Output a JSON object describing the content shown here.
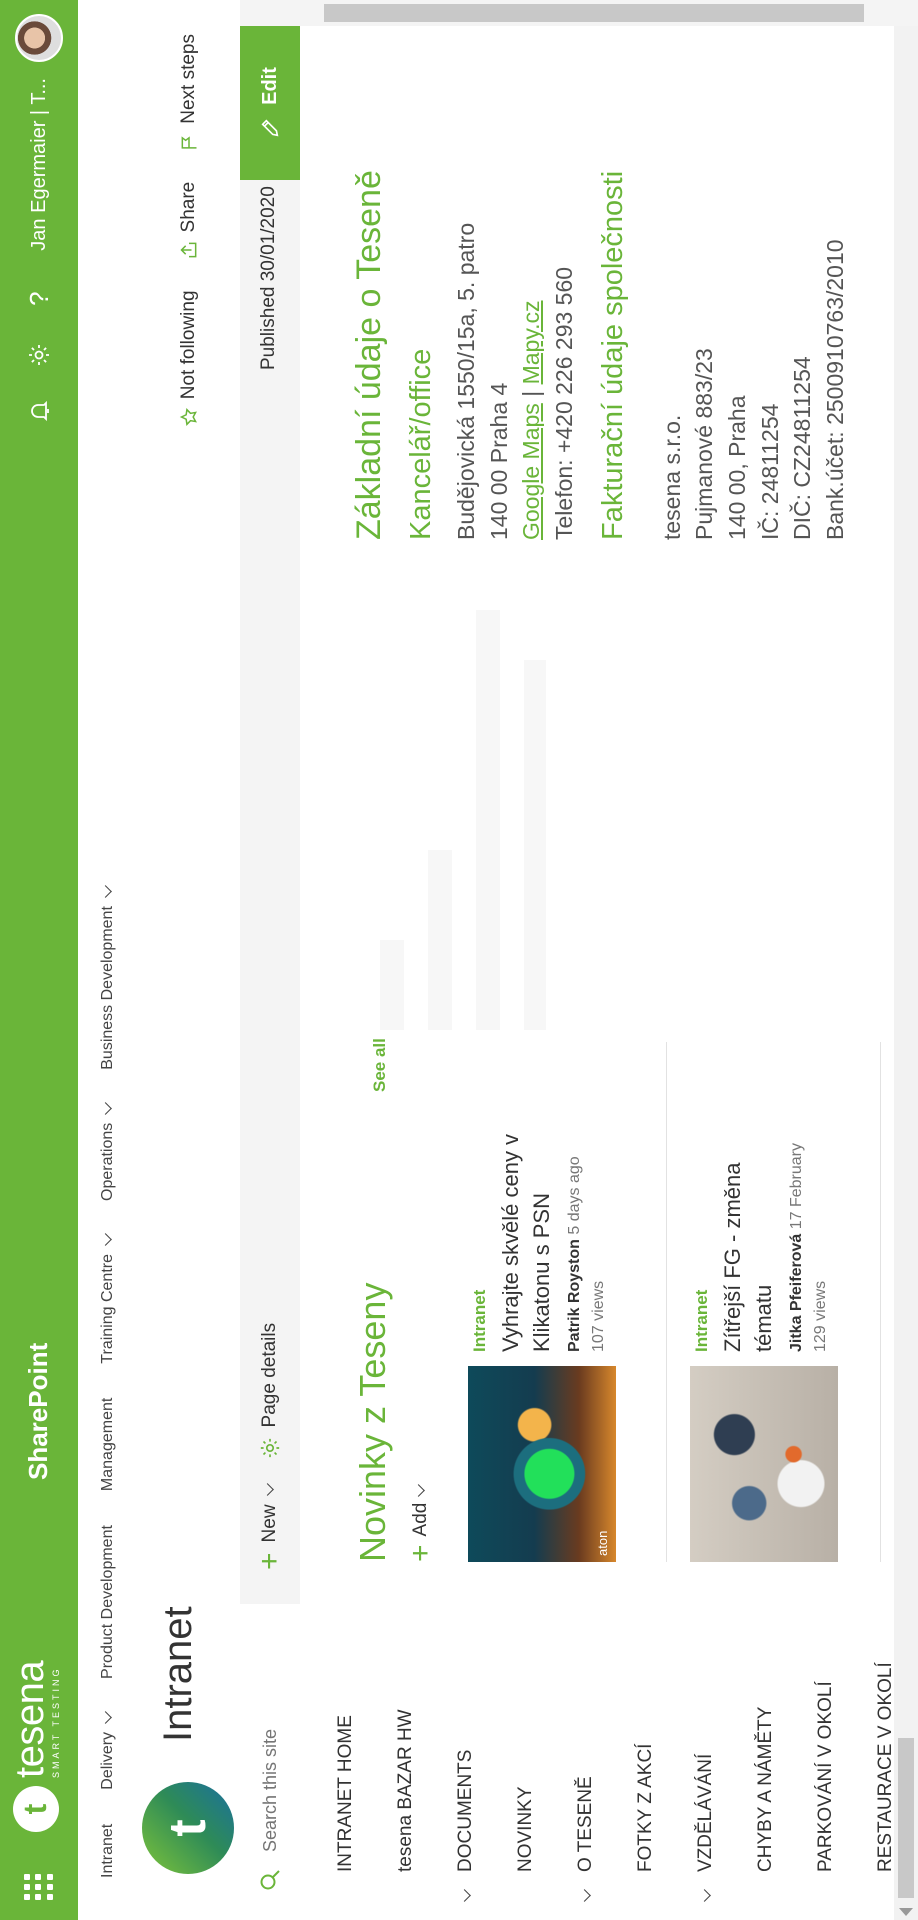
{
  "suite": {
    "brand_name": "tesena",
    "brand_tagline": "SMART TESTING",
    "app_title": "SharePoint",
    "user_name": "Jan Egermaier | T...",
    "accent": "#6ab539"
  },
  "topnav": [
    {
      "label": "Intranet",
      "has_menu": false
    },
    {
      "label": "Delivery",
      "has_menu": true
    },
    {
      "label": "Product Development",
      "has_menu": false
    },
    {
      "label": "Management",
      "has_menu": false
    },
    {
      "label": "Training Centre",
      "has_menu": true
    },
    {
      "label": "Operations",
      "has_menu": true
    },
    {
      "label": "Business Development",
      "has_menu": true
    }
  ],
  "site": {
    "title": "Intranet",
    "actions": {
      "follow": "Not following",
      "share": "Share",
      "next_steps": "Next steps"
    }
  },
  "commandbar": {
    "search_placeholder": "Search this site",
    "new_label": "New",
    "page_details_label": "Page details",
    "published": "Published 30/01/2020",
    "edit_label": "Edit"
  },
  "leftnav": [
    {
      "label": "INTRANET HOME",
      "expandable": false
    },
    {
      "label": "tesena BAZAR HW",
      "expandable": false
    },
    {
      "label": "DOCUMENTS",
      "expandable": true
    },
    {
      "label": "NOVINKY",
      "expandable": false
    },
    {
      "label": "O TESENĚ",
      "expandable": true
    },
    {
      "label": "FOTKY Z AKCÍ",
      "expandable": false
    },
    {
      "label": "VZDĚLÁVÁNÍ",
      "expandable": true
    },
    {
      "label": "CHYBY A NÁMĚTY",
      "expandable": false
    },
    {
      "label": "PARKOVÁNÍ V OKOLÍ",
      "expandable": false
    },
    {
      "label": "RESTAURACE V OKOLÍ",
      "expandable": false
    }
  ],
  "news": {
    "title": "Novinky z Teseny",
    "see_all": "See all",
    "add_label": "Add",
    "items": [
      {
        "category": "Intranet",
        "title": "Vyhrajte skvělé ceny v Klikatonu s PSN",
        "author": "Patrik Royston",
        "date": "5 days ago",
        "views": "107 views",
        "image_caption": "aton"
      },
      {
        "category": "Intranet",
        "title": "Zítřejší FG - změna tématu",
        "author": "Jitka Pfeiferová",
        "date": "17 February",
        "views": "129 views"
      }
    ]
  },
  "info": {
    "heading": "Základní údaje o Teseně",
    "office_heading": "Kancelář/office",
    "address_line1": "Budějovická 1550/15a, 5. patro",
    "address_line2": "140 00 Praha 4",
    "maps_google": "Google Maps",
    "maps_separator": "|",
    "maps_mapy": "Mapy.cz",
    "phone": "Telefon: +420 226 293 560",
    "billing_heading": "Fakturační údaje společnosti",
    "company": "tesena s.r.o.",
    "street": "Pujmanové 883/23",
    "city": "140 00, Praha",
    "ico": "IČ: 24811254",
    "dic": "DIČ: CZ24811254",
    "bank": "Bank.účet: 2500910763/2010"
  }
}
